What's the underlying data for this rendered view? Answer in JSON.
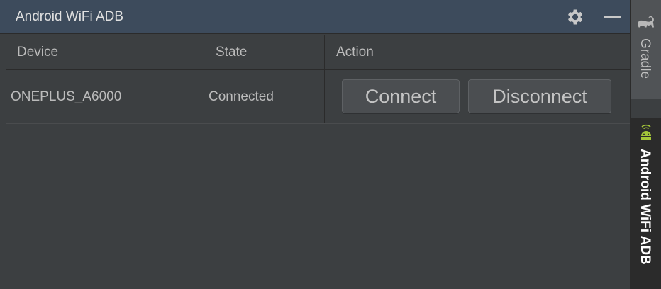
{
  "window": {
    "title": "Android WiFi ADB",
    "settings_icon": "gear-icon",
    "minimize_icon": "minimize-icon"
  },
  "table": {
    "columns": [
      "Device",
      "State",
      "Action"
    ],
    "rows": [
      {
        "device": "ONEPLUS_A6000",
        "state": "Connected",
        "actions": {
          "connect": "Connect",
          "disconnect": "Disconnect"
        }
      }
    ]
  },
  "sidebar": {
    "tabs": [
      {
        "label": "Gradle",
        "icon": "gradle-elephant-icon"
      },
      {
        "label": "Android WiFi ADB",
        "icon": "android-wifi-icon",
        "active": true
      }
    ]
  },
  "colors": {
    "titlebar": "#3d4b5c",
    "panel": "#3c3f41",
    "button": "#4b4e51",
    "active_tab": "#2b2b2b",
    "android_green": "#a4c639"
  }
}
